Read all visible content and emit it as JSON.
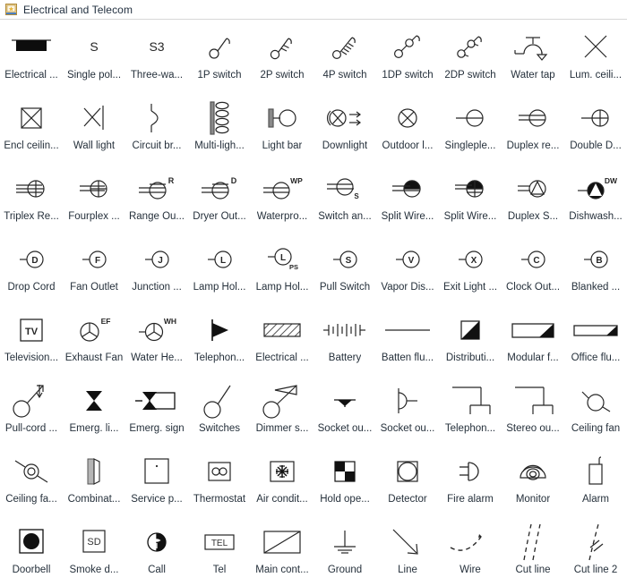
{
  "window": {
    "title": "Electrical and Telecom",
    "icon": "stencil-library-icon",
    "text_color": "#25303b",
    "stroke_color": "#262626",
    "border_color": "#d8d8d8",
    "icon_accent": "#f2c14e"
  },
  "grid": {
    "columns": 10,
    "rows": 8,
    "items": [
      {
        "label": "Electrical ...",
        "icon": "electrical-panel-symbol"
      },
      {
        "label": "Single pol...",
        "icon": "single-pole-switch-symbol",
        "text": "S"
      },
      {
        "label": "Three-wa...",
        "icon": "three-way-switch-symbol",
        "text": "S3"
      },
      {
        "label": "1P switch",
        "icon": "1p-switch-symbol"
      },
      {
        "label": "2P switch",
        "icon": "2p-switch-symbol"
      },
      {
        "label": "4P switch",
        "icon": "4p-switch-symbol"
      },
      {
        "label": "1DP switch",
        "icon": "1dp-switch-symbol"
      },
      {
        "label": "2DP switch",
        "icon": "2dp-switch-symbol"
      },
      {
        "label": "Water tap",
        "icon": "water-tap-symbol"
      },
      {
        "label": "Lum. ceili...",
        "icon": "luminous-ceiling-symbol"
      },
      {
        "label": "Encl ceilin...",
        "icon": "enclosed-ceiling-light-symbol"
      },
      {
        "label": "Wall light",
        "icon": "wall-light-symbol"
      },
      {
        "label": "Circuit br...",
        "icon": "circuit-breaker-symbol"
      },
      {
        "label": "Multi-ligh...",
        "icon": "multi-light-bar-symbol"
      },
      {
        "label": "Light bar",
        "icon": "light-bar-symbol"
      },
      {
        "label": "Downlight",
        "icon": "downlight-symbol"
      },
      {
        "label": "Outdoor l...",
        "icon": "outdoor-light-symbol"
      },
      {
        "label": "Singleple...",
        "icon": "singleplex-receptacle-symbol"
      },
      {
        "label": "Duplex re...",
        "icon": "duplex-receptacle-symbol"
      },
      {
        "label": "Double D...",
        "icon": "double-duplex-receptacle-symbol"
      },
      {
        "label": "Triplex Re...",
        "icon": "triplex-receptacle-symbol"
      },
      {
        "label": "Fourplex ...",
        "icon": "fourplex-receptacle-symbol"
      },
      {
        "label": "Range Ou...",
        "icon": "range-outlet-symbol",
        "text": "R"
      },
      {
        "label": "Dryer Out...",
        "icon": "dryer-outlet-symbol",
        "text": "D"
      },
      {
        "label": "Waterpro...",
        "icon": "waterproof-outlet-symbol",
        "text": "WP"
      },
      {
        "label": "Switch an...",
        "icon": "switch-and-receptacle-symbol",
        "text": "S"
      },
      {
        "label": "Split Wire...",
        "icon": "split-wired-duplex-symbol"
      },
      {
        "label": "Split Wire...",
        "icon": "split-wired-quad-symbol"
      },
      {
        "label": "Duplex S...",
        "icon": "duplex-special-purpose-symbol"
      },
      {
        "label": "Dishwash...",
        "icon": "dishwasher-outlet-symbol",
        "text": "DW"
      },
      {
        "label": "Drop Cord",
        "icon": "drop-cord-symbol",
        "text": "D"
      },
      {
        "label": "Fan Outlet",
        "icon": "fan-outlet-symbol",
        "text": "F"
      },
      {
        "label": "Junction ...",
        "icon": "junction-box-symbol",
        "text": "J"
      },
      {
        "label": "Lamp Hol...",
        "icon": "lamp-holder-symbol",
        "text": "L"
      },
      {
        "label": "Lamp Hol...",
        "icon": "lamp-holder-pull-switch-symbol",
        "text": "L",
        "sub": "PS"
      },
      {
        "label": "Pull Switch",
        "icon": "pull-switch-symbol",
        "text": "S"
      },
      {
        "label": "Vapor Dis...",
        "icon": "vapor-discharge-lamp-symbol",
        "text": "V"
      },
      {
        "label": "Exit Light ...",
        "icon": "exit-light-symbol",
        "text": "X"
      },
      {
        "label": "Clock Out...",
        "icon": "clock-outlet-symbol",
        "text": "C"
      },
      {
        "label": "Blanked ...",
        "icon": "blanked-outlet-symbol",
        "text": "B"
      },
      {
        "label": "Television...",
        "icon": "television-outlet-symbol",
        "text": "TV"
      },
      {
        "label": "Exhaust Fan",
        "icon": "exhaust-fan-symbol",
        "text": "EF"
      },
      {
        "label": "Water He...",
        "icon": "water-heater-symbol",
        "text": "WH"
      },
      {
        "label": "Telephon...",
        "icon": "telephone-jack-symbol"
      },
      {
        "label": "Electrical ...",
        "icon": "electrical-hatched-box-symbol"
      },
      {
        "label": "Battery",
        "icon": "battery-symbol"
      },
      {
        "label": "Batten flu...",
        "icon": "batten-fluorescent-symbol"
      },
      {
        "label": "Distributi...",
        "icon": "distribution-board-symbol"
      },
      {
        "label": "Modular f...",
        "icon": "modular-fluorescent-symbol"
      },
      {
        "label": "Office flu...",
        "icon": "office-fluorescent-symbol"
      },
      {
        "label": "Pull-cord ...",
        "icon": "pull-cord-switch-symbol"
      },
      {
        "label": "Emerg. li...",
        "icon": "emergency-light-symbol"
      },
      {
        "label": "Emerg. sign",
        "icon": "emergency-sign-symbol"
      },
      {
        "label": "Switches",
        "icon": "switches-symbol"
      },
      {
        "label": "Dimmer s...",
        "icon": "dimmer-switch-symbol"
      },
      {
        "label": "Socket ou...",
        "icon": "socket-outlet-filled-symbol"
      },
      {
        "label": "Socket ou...",
        "icon": "socket-outlet-outline-symbol"
      },
      {
        "label": "Telephon...",
        "icon": "telephone-outlet-symbol"
      },
      {
        "label": "Stereo ou...",
        "icon": "stereo-outlet-symbol"
      },
      {
        "label": "Ceiling fan",
        "icon": "ceiling-fan-symbol"
      },
      {
        "label": "Ceiling fa...",
        "icon": "ceiling-fan-light-symbol"
      },
      {
        "label": "Combinat...",
        "icon": "combination-unit-symbol"
      },
      {
        "label": "Service p...",
        "icon": "service-panel-symbol"
      },
      {
        "label": "Thermostat",
        "icon": "thermostat-symbol"
      },
      {
        "label": "Air condit...",
        "icon": "air-conditioner-symbol"
      },
      {
        "label": "Hold ope...",
        "icon": "hold-open-device-symbol"
      },
      {
        "label": "Detector",
        "icon": "detector-symbol"
      },
      {
        "label": "Fire alarm",
        "icon": "fire-alarm-symbol"
      },
      {
        "label": "Monitor",
        "icon": "monitor-camera-symbol"
      },
      {
        "label": "Alarm",
        "icon": "alarm-symbol"
      },
      {
        "label": "Doorbell",
        "icon": "doorbell-symbol"
      },
      {
        "label": "Smoke d...",
        "icon": "smoke-detector-symbol",
        "text": "SD"
      },
      {
        "label": "Call",
        "icon": "call-symbol"
      },
      {
        "label": "Tel",
        "icon": "telephone-symbol",
        "text": "TEL"
      },
      {
        "label": "Main cont...",
        "icon": "main-control-symbol"
      },
      {
        "label": "Ground",
        "icon": "ground-symbol"
      },
      {
        "label": "Line",
        "icon": "line-symbol"
      },
      {
        "label": "Wire",
        "icon": "wire-symbol"
      },
      {
        "label": "Cut line",
        "icon": "cut-line-symbol"
      },
      {
        "label": "Cut line 2",
        "icon": "cut-line-2-symbol"
      }
    ]
  }
}
